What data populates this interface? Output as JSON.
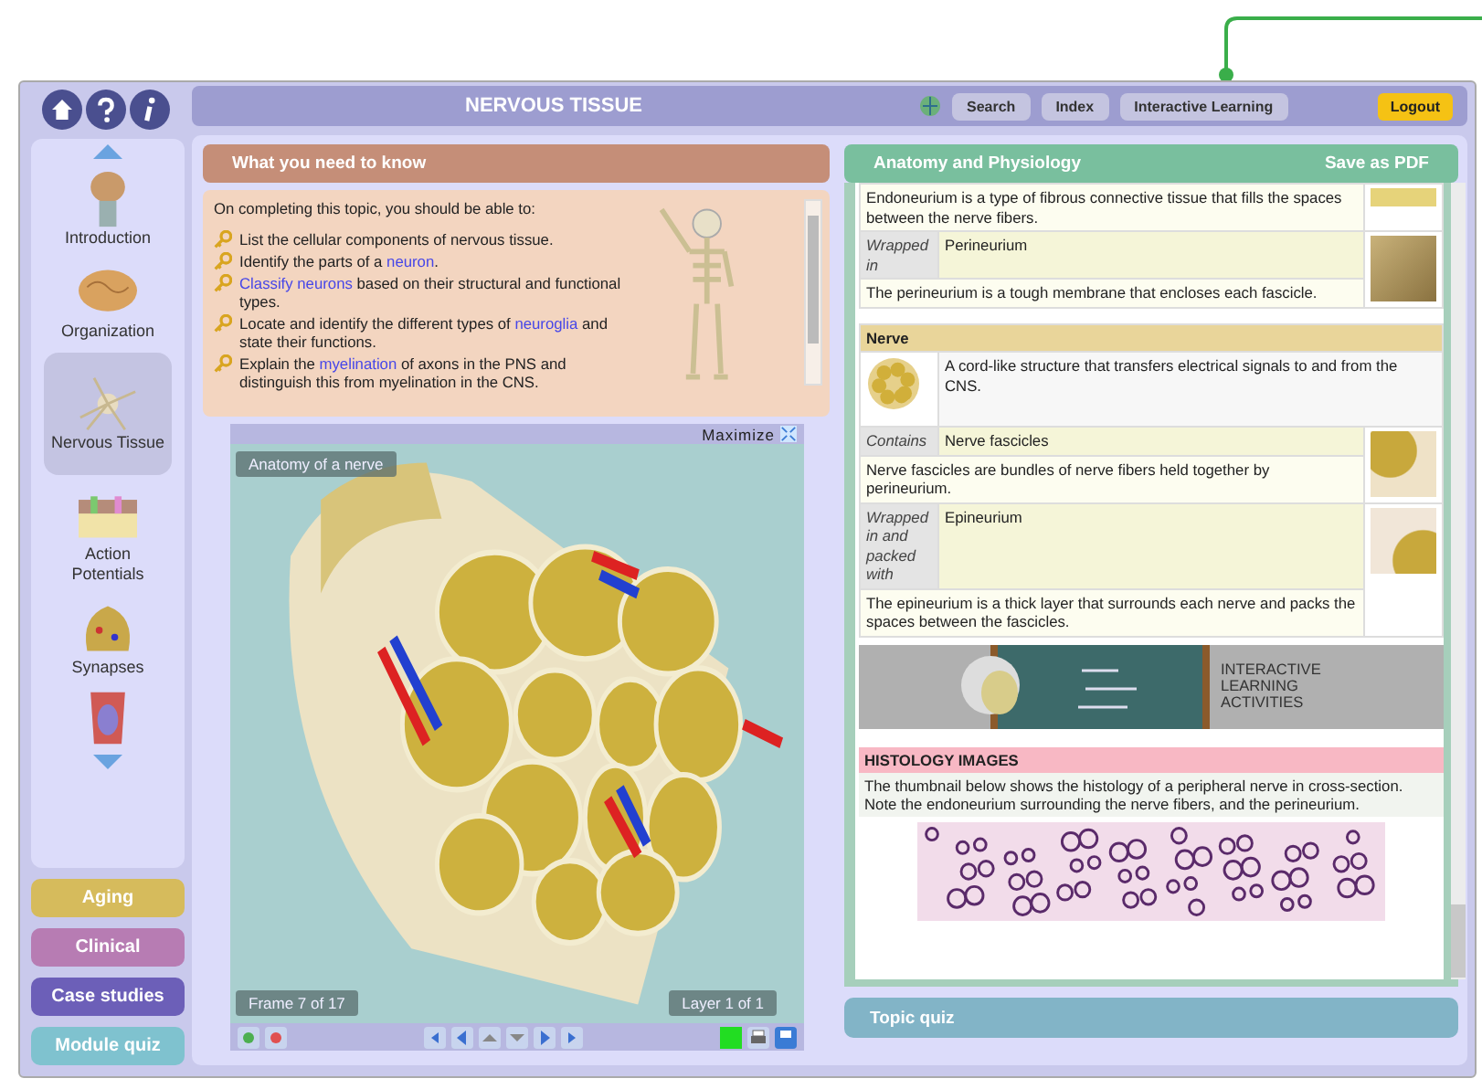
{
  "header": {
    "title": "NERVOUS TISSUE",
    "buttons": [
      "Search",
      "Index",
      "Interactive Learning"
    ],
    "logout": "Logout"
  },
  "topics": [
    {
      "label": "Introduction",
      "selected": false
    },
    {
      "label": "Organization",
      "selected": false
    },
    {
      "label": "Nervous Tissue",
      "selected": true
    },
    {
      "label": "Action Potentials",
      "selected": false
    },
    {
      "label": "Synapses",
      "selected": false
    }
  ],
  "section_buttons": [
    {
      "label": "Aging",
      "color": "#d6bb5c"
    },
    {
      "label": "Clinical",
      "color": "#b77cb3"
    },
    {
      "label": "Case studies",
      "color": "#6c5fb8"
    },
    {
      "label": "Module quiz",
      "color": "#7fc2cf"
    }
  ],
  "objectives": {
    "title": "What you need to know",
    "intro": "On completing this topic, you should be able to:",
    "items": [
      [
        {
          "text": "List the cellular components of nervous tissue.",
          "link": false
        }
      ],
      [
        {
          "text": "Identify the parts of a ",
          "link": false
        },
        {
          "text": "neuron",
          "link": true
        },
        {
          "text": ".",
          "link": false
        }
      ],
      [
        {
          "text": "Classify neurons",
          "link": true
        },
        {
          "text": " based on their structural and functional types.",
          "link": false
        }
      ],
      [
        {
          "text": "Locate and identify the different types of ",
          "link": false
        },
        {
          "text": "neuroglia",
          "link": true
        },
        {
          "text": " and state their functions.",
          "link": false
        }
      ],
      [
        {
          "text": "Explain the ",
          "link": false
        },
        {
          "text": "myelination",
          "link": true
        },
        {
          "text": " of axons in the PNS and distinguish this from myelination in the CNS.",
          "link": false
        }
      ]
    ]
  },
  "viewer": {
    "maximize": "Maximize",
    "caption": "Anatomy of a nerve",
    "frame": "Frame 7 of 17",
    "layer": "Layer 1 of 1"
  },
  "panel": {
    "title": "Anatomy and Physiology",
    "save": "Save as PDF",
    "top_desc": "Endoneurium is a type of fibrous connective tissue that fills the spaces between the nerve fibers.",
    "top_rows": [
      {
        "label": "Wrapped in",
        "value": "Perineurium",
        "desc": "The perineurium is a tough membrane that encloses each fascicle."
      }
    ],
    "nerve": {
      "title": "Nerve",
      "desc": "A cord-like structure that transfers electrical signals to and from the CNS.",
      "rows": [
        {
          "label": "Contains",
          "value": "Nerve fascicles",
          "desc": "Nerve fascicles are bundles of nerve fibers held together by perineurium."
        },
        {
          "label": "Wrapped in and packed with",
          "value": "Epineurium",
          "desc": "The epineurium is a thick layer that surrounds each nerve and packs the spaces between the fascicles."
        }
      ]
    },
    "banner": "INTERACTIVE LEARNING ACTIVITIES",
    "histology": {
      "title": "HISTOLOGY IMAGES",
      "desc": "The thumbnail below shows the histology of a peripheral nerve in cross-section. Note the endoneurium surrounding the nerve fibers, and the perineurium."
    }
  },
  "topic_quiz": "Topic quiz"
}
